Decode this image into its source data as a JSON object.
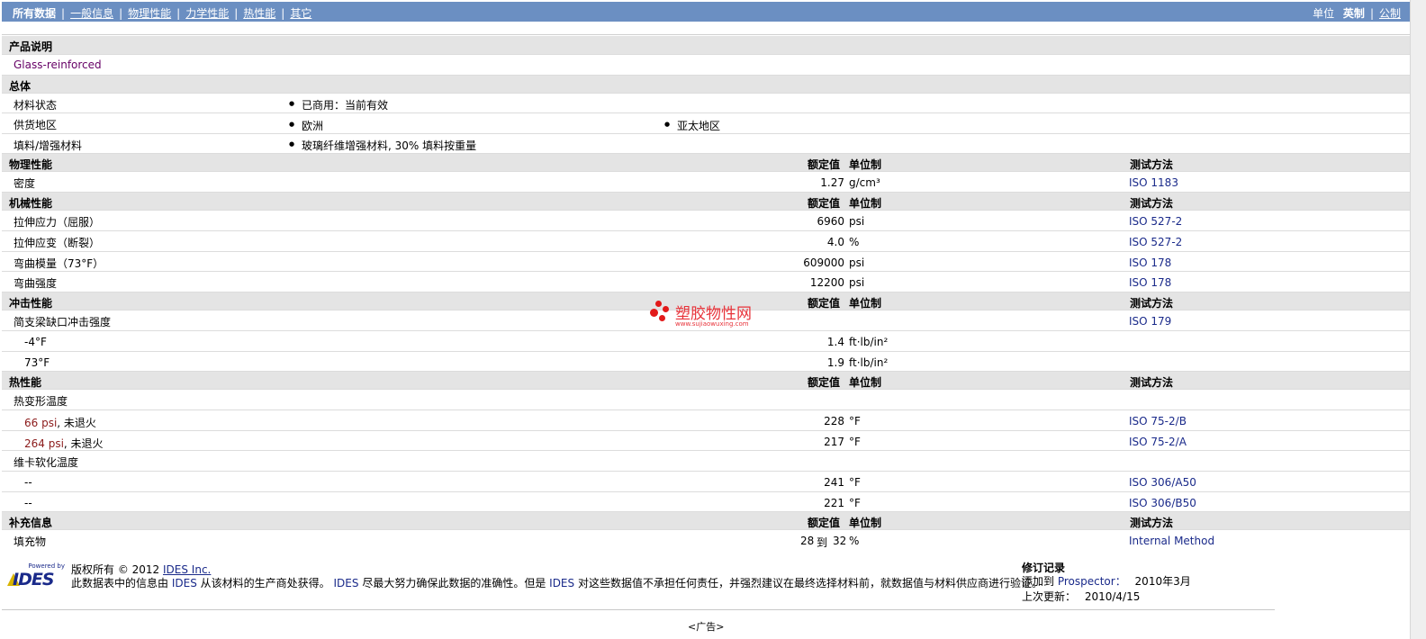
{
  "nav": {
    "all_data": "所有数据",
    "general": "一般信息",
    "physical": "物理性能",
    "mechanical": "力学性能",
    "thermal": "热性能",
    "other": "其它",
    "units_label": "单位",
    "imperial": "英制",
    "metric": "公制"
  },
  "description": {
    "header": "产品说明",
    "text": "Glass-reinforced"
  },
  "general": {
    "header": "总体",
    "material_status_label": "材料状态",
    "material_status_value": "已商用：当前有效",
    "availability_label": "供货地区",
    "availability_1": "欧洲",
    "availability_2": "亚太地区",
    "filler_label": "填料/增强材料",
    "filler_value": "玻璃纤维增强材料, 30% 填料按重量"
  },
  "col": {
    "nominal": "额定值",
    "unit": "单位制",
    "method": "测试方法"
  },
  "physical": {
    "header": "物理性能",
    "rows": [
      {
        "label": "密度",
        "value": "1.27",
        "unit": "g/cm³",
        "method": "ISO 1183"
      }
    ]
  },
  "mechanical": {
    "header": "机械性能",
    "rows": [
      {
        "label": "拉伸应力（屈服）",
        "value": "6960",
        "unit": "psi",
        "method": "ISO 527-2"
      },
      {
        "label": "拉伸应变（断裂）",
        "value": "4.0",
        "unit": "%",
        "method": "ISO 527-2"
      },
      {
        "label": "弯曲模量（73°F）",
        "value": "609000",
        "unit": "psi",
        "method": "ISO 178"
      },
      {
        "label": "弯曲强度",
        "value": "12200",
        "unit": "psi",
        "method": "ISO 178"
      }
    ]
  },
  "impact": {
    "header": "冲击性能",
    "charpy_label": "简支梁缺口冲击强度",
    "charpy_method": "ISO 179",
    "rows": [
      {
        "label": "-4°F",
        "value": "1.4",
        "unit": "ft·lb/in²"
      },
      {
        "label": "73°F",
        "value": "1.9",
        "unit": "ft·lb/in²"
      }
    ]
  },
  "thermal": {
    "header": "热性能",
    "hdt_label": "热变形温度",
    "hdt_rows": [
      {
        "label_a": "66 psi",
        "label_b": ", 未退火",
        "value": "228",
        "unit": "°F",
        "method": "ISO 75-2/B"
      },
      {
        "label_a": "264 psi",
        "label_b": ", 未退火",
        "value": "217",
        "unit": "°F",
        "method": "ISO 75-2/A"
      }
    ],
    "vicat_label": "维卡软化温度",
    "vicat_rows": [
      {
        "label": "--",
        "value": "241",
        "unit": "°F",
        "method": "ISO 306/A50"
      },
      {
        "label": "--",
        "value": "221",
        "unit": "°F",
        "method": "ISO 306/B50"
      }
    ]
  },
  "supplemental": {
    "header": "补充信息",
    "rows": [
      {
        "label": "填充物",
        "value_a": "28",
        "to": "到",
        "value_b": "32",
        "unit": "%",
        "method": "Internal Method"
      }
    ]
  },
  "footer": {
    "powered_by": "Powered by",
    "logo_text": "IDES",
    "copyright": "版权所有 © 2012",
    "company": "IDES Inc.",
    "disclaimer_1": "此数据表中的信息由",
    "ides_1": "IDES",
    "disclaimer_2": "从该材料的生产商处获得。",
    "ides_2": "IDES",
    "disclaimer_3": "尽最大努力确保此数据的准确性。但是",
    "ides_3": "IDES",
    "disclaimer_4": "对这些数据值不承担任何责任，并强烈建议在最终选择材料前，就数据值与材料供应商进行验证。",
    "revision_header": "修订记录",
    "added_label": "添加到",
    "added_target": "Prospector：",
    "added_date": "2010年3月",
    "updated_label": "上次更新：",
    "updated_date": "2010/4/15",
    "ad": "<广告>"
  },
  "watermark": {
    "name": "塑胶物性网",
    "url": "www.sujiaowuxing.com"
  }
}
